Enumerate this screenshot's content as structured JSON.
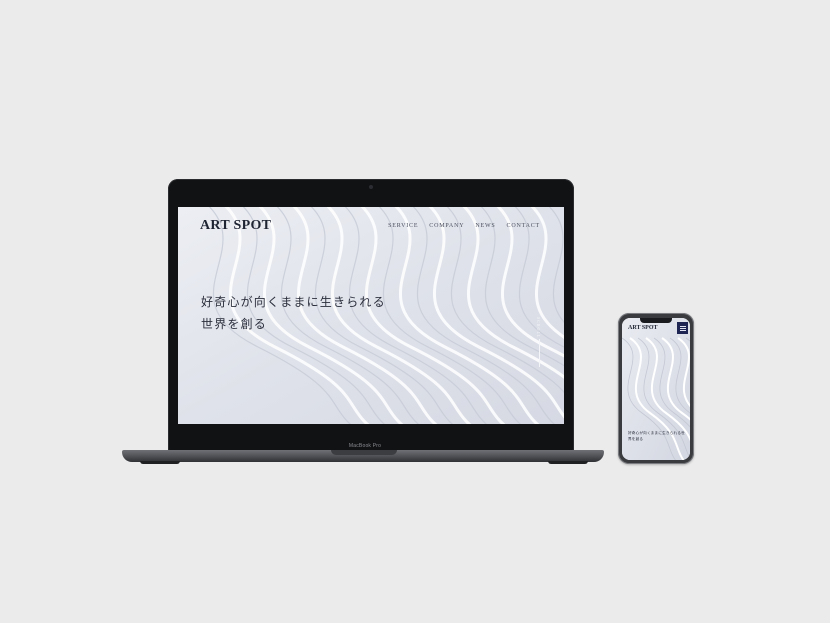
{
  "laptop": {
    "model_label": "MacBook Pro"
  },
  "site": {
    "logo": "ART SPOT",
    "nav": [
      "SERVICE",
      "COMPANY",
      "NEWS",
      "CONTACT"
    ],
    "hero_line_1": "好奇心が向くままに生きられる",
    "hero_line_2": "世界を創る",
    "scroll_label": "SCROLL"
  },
  "phone": {
    "logo": "ART SPOT",
    "hero_text": "好奇心が向くままに生きられる世界を創る",
    "menu_icon": "hamburger-icon"
  },
  "colors": {
    "page_bg": "#ebebeb",
    "accent_navy": "#1f2552",
    "text_dark": "#1f2433"
  }
}
